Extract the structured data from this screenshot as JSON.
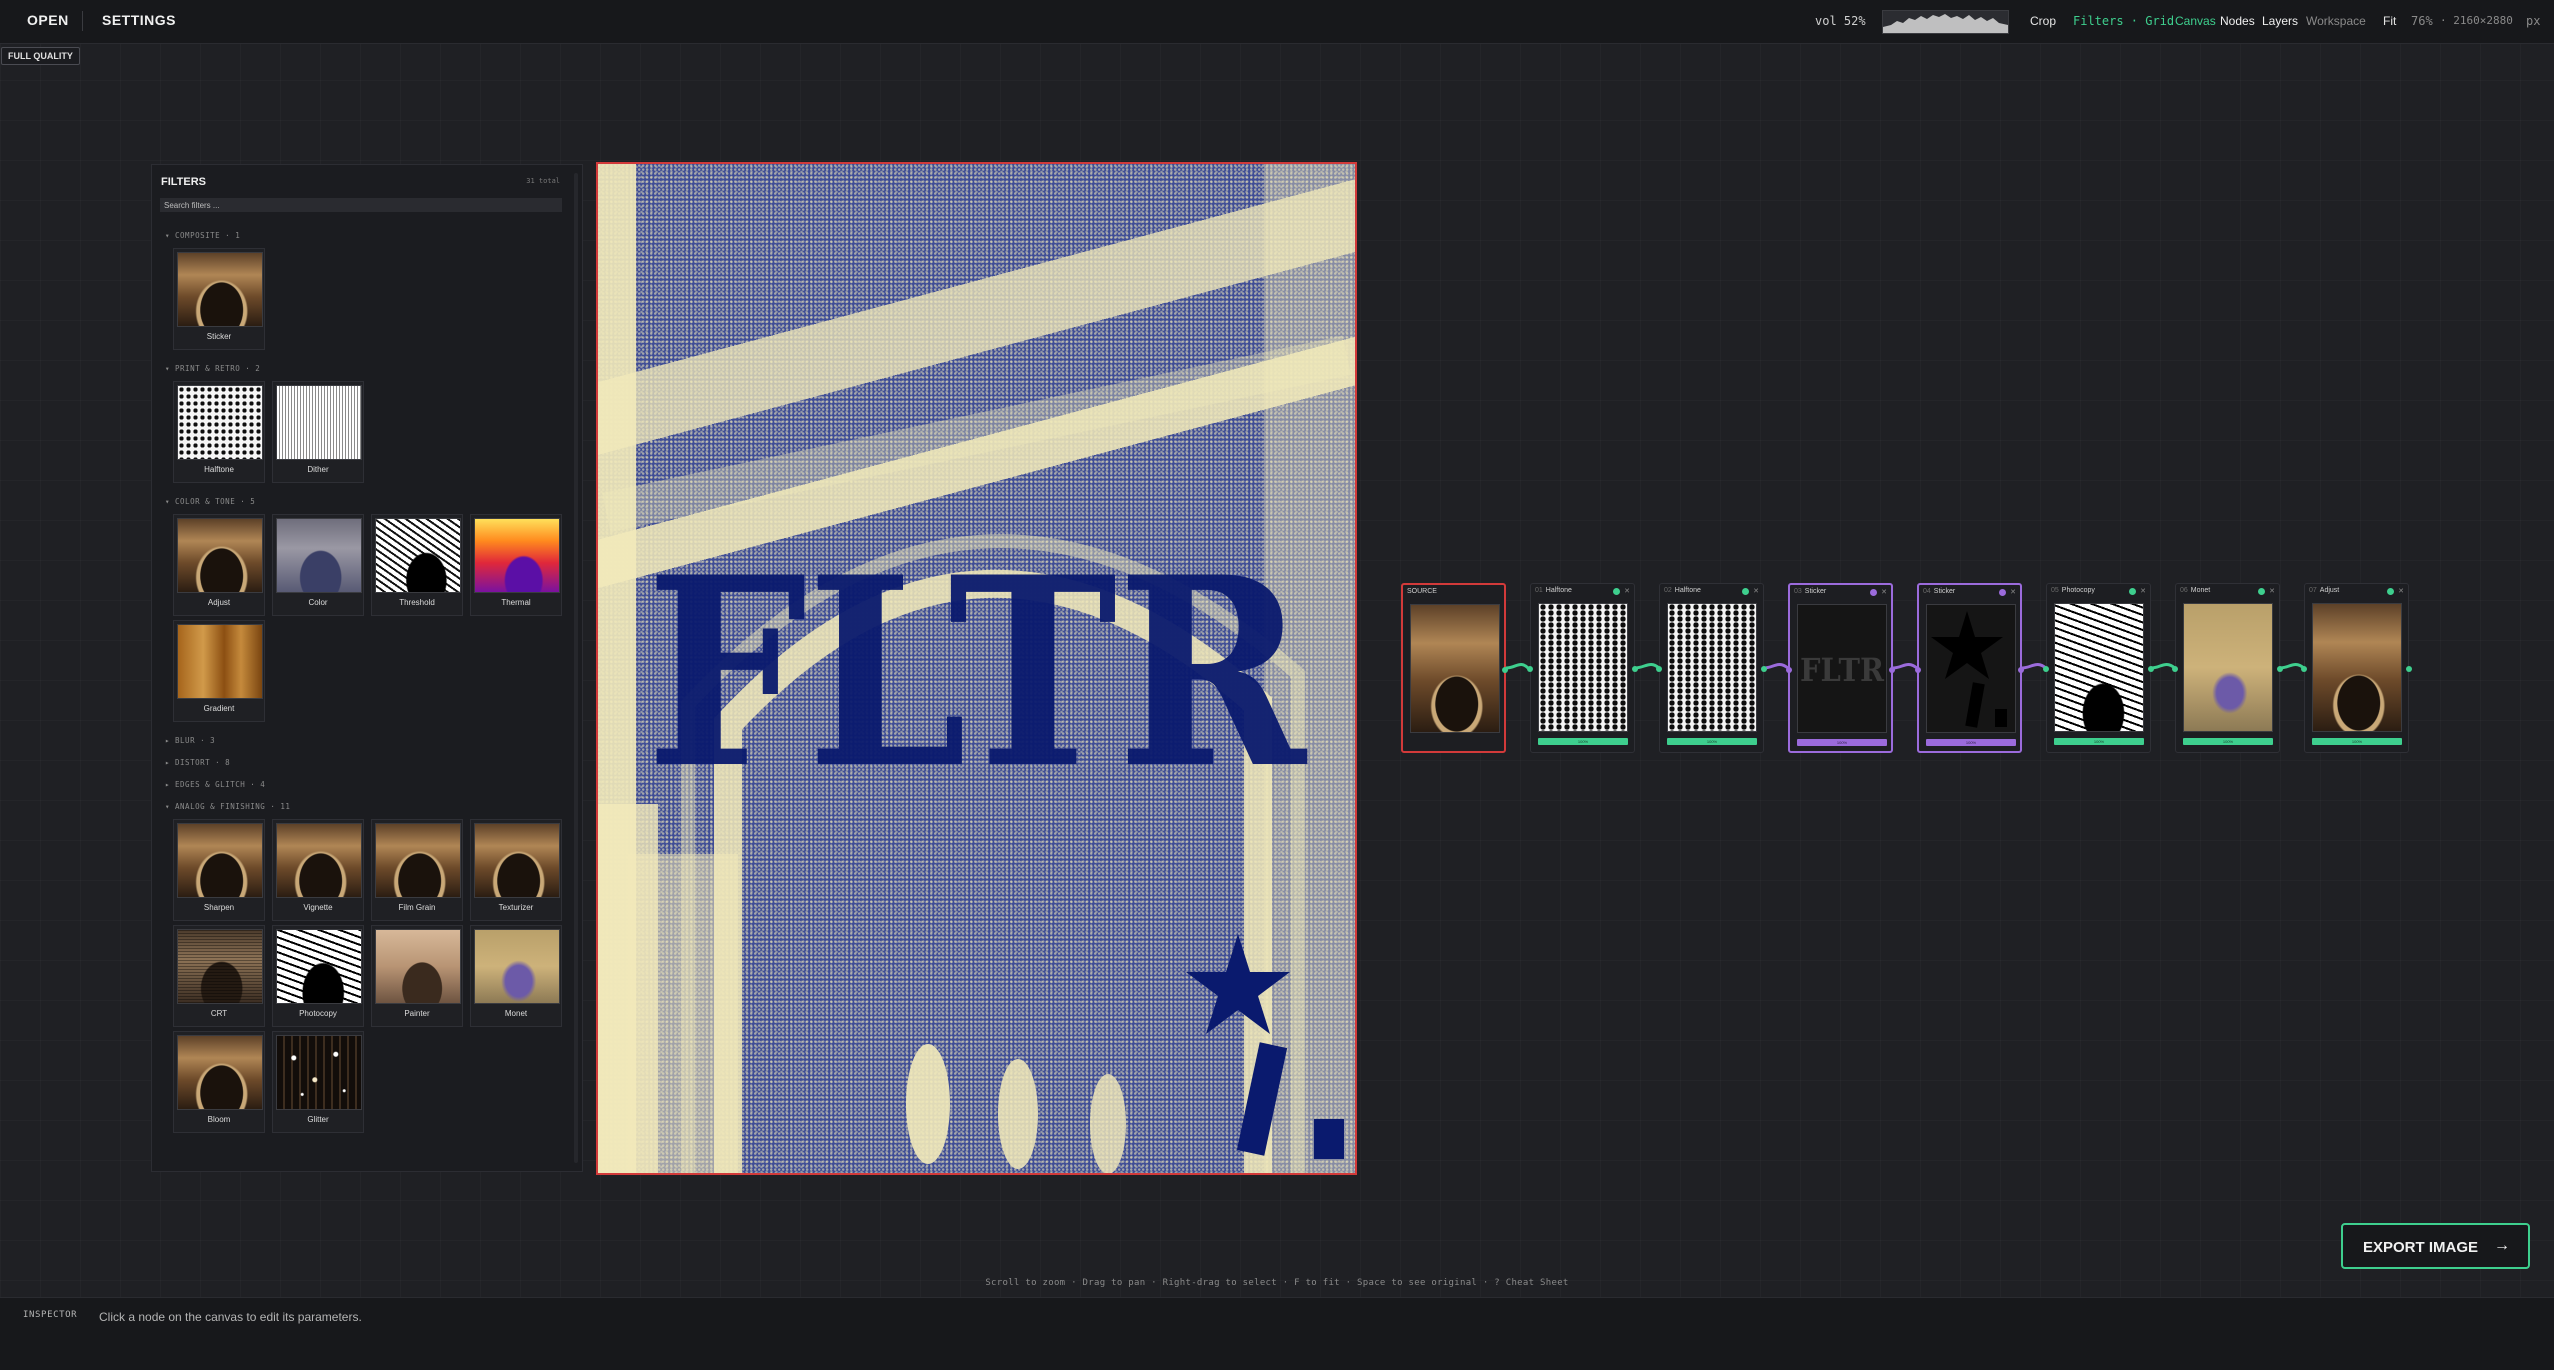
{
  "topbar": {
    "open": "OPEN",
    "settings": "SETTINGS",
    "vol": "vol 52%",
    "crop": "Crop",
    "filters_grid": "Filters · Grid",
    "canvas": "Canvas",
    "nodes": "Nodes",
    "layers": "Layers",
    "workspace": "Workspace",
    "fit": "Fit",
    "zoom": "76%",
    "dims": "· 2160×2880",
    "unit": "px"
  },
  "quality_badge": "FULL QUALITY",
  "filters": {
    "title": "FILTERS",
    "count": "31 total",
    "search_placeholder": "Search filters ...",
    "sections": [
      {
        "header": "▾ COMPOSITE · 1",
        "items": [
          "Sticker"
        ]
      },
      {
        "header": "▾ PRINT & RETRO · 2",
        "items": [
          "Halftone",
          "Dither"
        ]
      },
      {
        "header": "▾ COLOR & TONE · 5",
        "items": [
          "Adjust",
          "Color",
          "Threshold",
          "Thermal",
          "Gradient"
        ]
      },
      {
        "header": "▸ BLUR · 3",
        "items": []
      },
      {
        "header": "▸ DISTORT · 8",
        "items": []
      },
      {
        "header": "▸ EDGES & GLITCH · 4",
        "items": []
      },
      {
        "header": "▾ ANALOG & FINISHING · 11",
        "items": [
          "Sharpen",
          "Vignette",
          "Film Grain",
          "Texturizer",
          "CRT",
          "Photocopy",
          "Painter",
          "Monet",
          "Bloom",
          "Glitter"
        ]
      }
    ]
  },
  "preview": {
    "overlay_text": "FLTR"
  },
  "nodes": [
    {
      "num": "",
      "label": "SOURCE",
      "bar": ""
    },
    {
      "num": "01",
      "label": "Halftone",
      "bar": "100%"
    },
    {
      "num": "02",
      "label": "Halftone",
      "bar": "100%"
    },
    {
      "num": "03",
      "label": "Sticker",
      "bar": "100%"
    },
    {
      "num": "04",
      "label": "Sticker",
      "bar": "100%"
    },
    {
      "num": "05",
      "label": "Photocopy",
      "bar": "100%"
    },
    {
      "num": "06",
      "label": "Monet",
      "bar": "100%"
    },
    {
      "num": "07",
      "label": "Adjust",
      "bar": "100%"
    }
  ],
  "sticker_node_text": "FLTR",
  "export": {
    "label": "EXPORT IMAGE",
    "arrow": "→"
  },
  "hints": "Scroll to zoom · Drag to pan · Right-drag to select · F to fit · Space to see original · ? Cheat Sheet",
  "inspector": {
    "label": "INSPECTOR",
    "message": "Click a node on the canvas to edit its parameters."
  },
  "colors": {
    "accent": "#3ecf8e",
    "sticker": "#9b6bdc",
    "source": "#d23a3a"
  }
}
